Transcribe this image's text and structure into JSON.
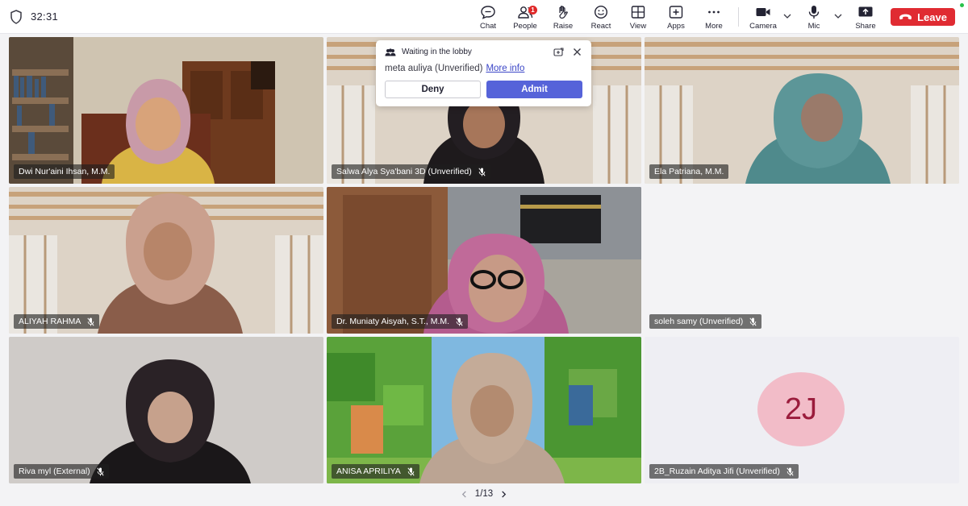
{
  "meeting": {
    "timer": "32:31"
  },
  "toolbar": {
    "chat": "Chat",
    "people": "People",
    "people_badge": "1",
    "raise": "Raise",
    "react": "React",
    "view": "View",
    "apps": "Apps",
    "more": "More",
    "camera": "Camera",
    "mic": "Mic",
    "share": "Share",
    "leave": "Leave"
  },
  "lobby": {
    "title": "Waiting in the lobby",
    "name": "meta auliya (Unverified)",
    "more_info": "More info",
    "deny": "Deny",
    "admit": "Admit"
  },
  "participants": [
    {
      "name": "Dwi Nur'aini Ihsan, M.M.",
      "muted": false
    },
    {
      "name": "Salwa Alya Sya'bani 3D (Unverified)",
      "muted": true
    },
    {
      "name": "Ela Patriana, M.M.",
      "muted": false
    },
    {
      "name": "ALIYAH RAHMA",
      "muted": true
    },
    {
      "name": "Dr. Muniaty Aisyah, S.T., M.M.",
      "muted": true,
      "active_speaker": true
    },
    {
      "name": "soleh samy (Unverified)",
      "muted": true,
      "camera_off": true
    },
    {
      "name": "Riva myl (External)",
      "muted": true
    },
    {
      "name": "ANISA APRILIYA",
      "muted": true
    },
    {
      "name": "2B_Ruzain Aditya Jifi (Unverified)",
      "muted": true,
      "avatar_initials": "2J"
    }
  ],
  "pager": {
    "label": "1/13"
  },
  "colors": {
    "leave": "#e02b32",
    "admit": "#5663d9",
    "active_border": "#6b74e8",
    "avatar_bg": "#f2bcc8",
    "avatar_text": "#9b1c3c"
  }
}
